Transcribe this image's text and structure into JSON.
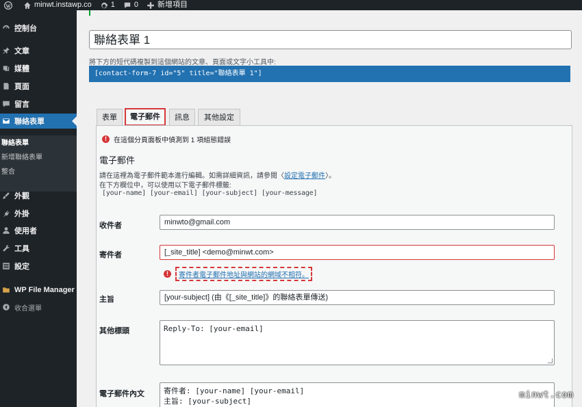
{
  "adminbar": {
    "site_name": "minwt.instawp.co",
    "updates_count": "1",
    "comments_count": "0",
    "new_label": "新增項目"
  },
  "sidebar": {
    "items": [
      {
        "label": "控制台",
        "icon": "dashboard-icon"
      },
      {
        "label": "文章",
        "icon": "pin-icon"
      },
      {
        "label": "媒體",
        "icon": "media-icon"
      },
      {
        "label": "頁面",
        "icon": "page-icon"
      },
      {
        "label": "留言",
        "icon": "comment-icon"
      },
      {
        "label": "聯絡表單",
        "icon": "mail-icon"
      },
      {
        "label": "外觀",
        "icon": "brush-icon"
      },
      {
        "label": "外掛",
        "icon": "plugin-icon"
      },
      {
        "label": "使用者",
        "icon": "user-icon"
      },
      {
        "label": "工具",
        "icon": "wrench-icon"
      },
      {
        "label": "設定",
        "icon": "settings-icon"
      },
      {
        "label": "WP File Manager",
        "icon": "folder-icon"
      },
      {
        "label": "收合選單",
        "icon": "collapse-icon"
      }
    ],
    "submenu": [
      "聯絡表單",
      "新增聯絡表單",
      "整合"
    ]
  },
  "form": {
    "title": "聯絡表單 1",
    "shortcode_desc": "將下方的短代碼複製到這個網站的文章、頁面或文字小工具中:",
    "shortcode": "[contact-form-7 id=\"5\" title=\"聯絡表單 1\"]",
    "tabs": [
      "表單",
      "電子郵件",
      "訊息",
      "其他設定"
    ],
    "config_error": "在這個分頁面板中偵測到 1 項組態錯誤",
    "section_title": "電子郵件",
    "desc1_before": "請在這裡為電子郵件範本進行編輯。如需詳細資訊，請參閱〈",
    "desc1_link": "設定電子郵件",
    "desc1_after": "〉。",
    "desc2": "在下方欄位中，可以使用以下電子郵件標籤:",
    "tags": "[your-name] [your-email] [your-subject] [your-message]",
    "fields": {
      "to_label": "收件者",
      "to_value": "minwto@gmail.com",
      "from_label": "寄件者",
      "from_value": "[_site_title] <demo@minwt.com>",
      "from_error": "寄件者電子郵件地址與網站的網域不相符。",
      "subject_label": "主旨",
      "subject_value": "[your-subject] (由《[_site_title]》的聯絡表單傳送)",
      "headers_label": "其他標頭",
      "headers_value": "Reply-To: [your-email]",
      "body_label": "電子郵件內文",
      "body_line1": "寄件者: [your-name] [your-email]",
      "body_line2": "主旨: [your-subject]"
    }
  },
  "watermark": "minwt.com",
  "colors": {
    "accent": "#2271b1",
    "error": "#d63638",
    "sidebar": "#1d2327"
  }
}
